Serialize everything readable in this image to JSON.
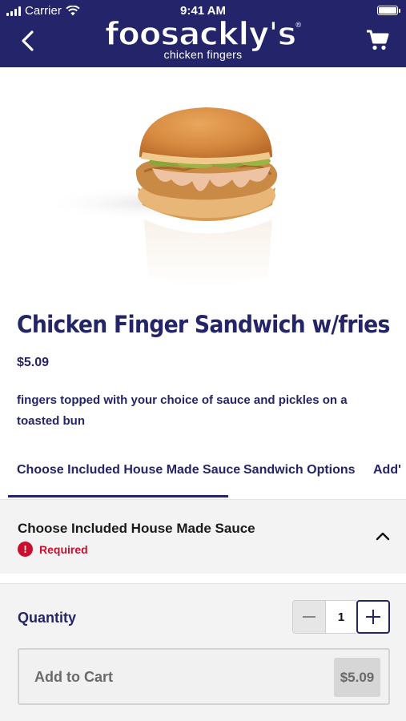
{
  "status_bar": {
    "carrier": "Carrier",
    "time": "9:41 AM"
  },
  "header": {
    "brand": "foosackly's",
    "registered": "®",
    "tagline": "chicken fingers"
  },
  "product": {
    "title": "Chicken Finger Sandwich w/fries",
    "price": "$5.09",
    "description": "fingers topped with your choice of sauce and pickles on a toasted bun"
  },
  "tabs": [
    {
      "label": "Choose Included House Made Sauce",
      "active": true
    },
    {
      "label": "Sandwich Options",
      "active": false
    },
    {
      "label": "Add'",
      "active": false
    }
  ],
  "sauce_section": {
    "title": "Choose Included House Made Sauce",
    "required_label": "Required",
    "required_icon": "!"
  },
  "quantity": {
    "label": "Quantity",
    "value": "1"
  },
  "cart_button": {
    "label": "Add to Cart",
    "price": "$5.09"
  },
  "colors": {
    "navy": "#24246b",
    "required_red": "#c8102e",
    "panel_grey": "#f3f3f3"
  },
  "icons": [
    "back-chevron-icon",
    "wifi-icon",
    "signal-icon",
    "battery-icon",
    "shopping-cart-icon",
    "chevron-up-icon",
    "alert-icon",
    "minus-icon",
    "plus-icon"
  ]
}
